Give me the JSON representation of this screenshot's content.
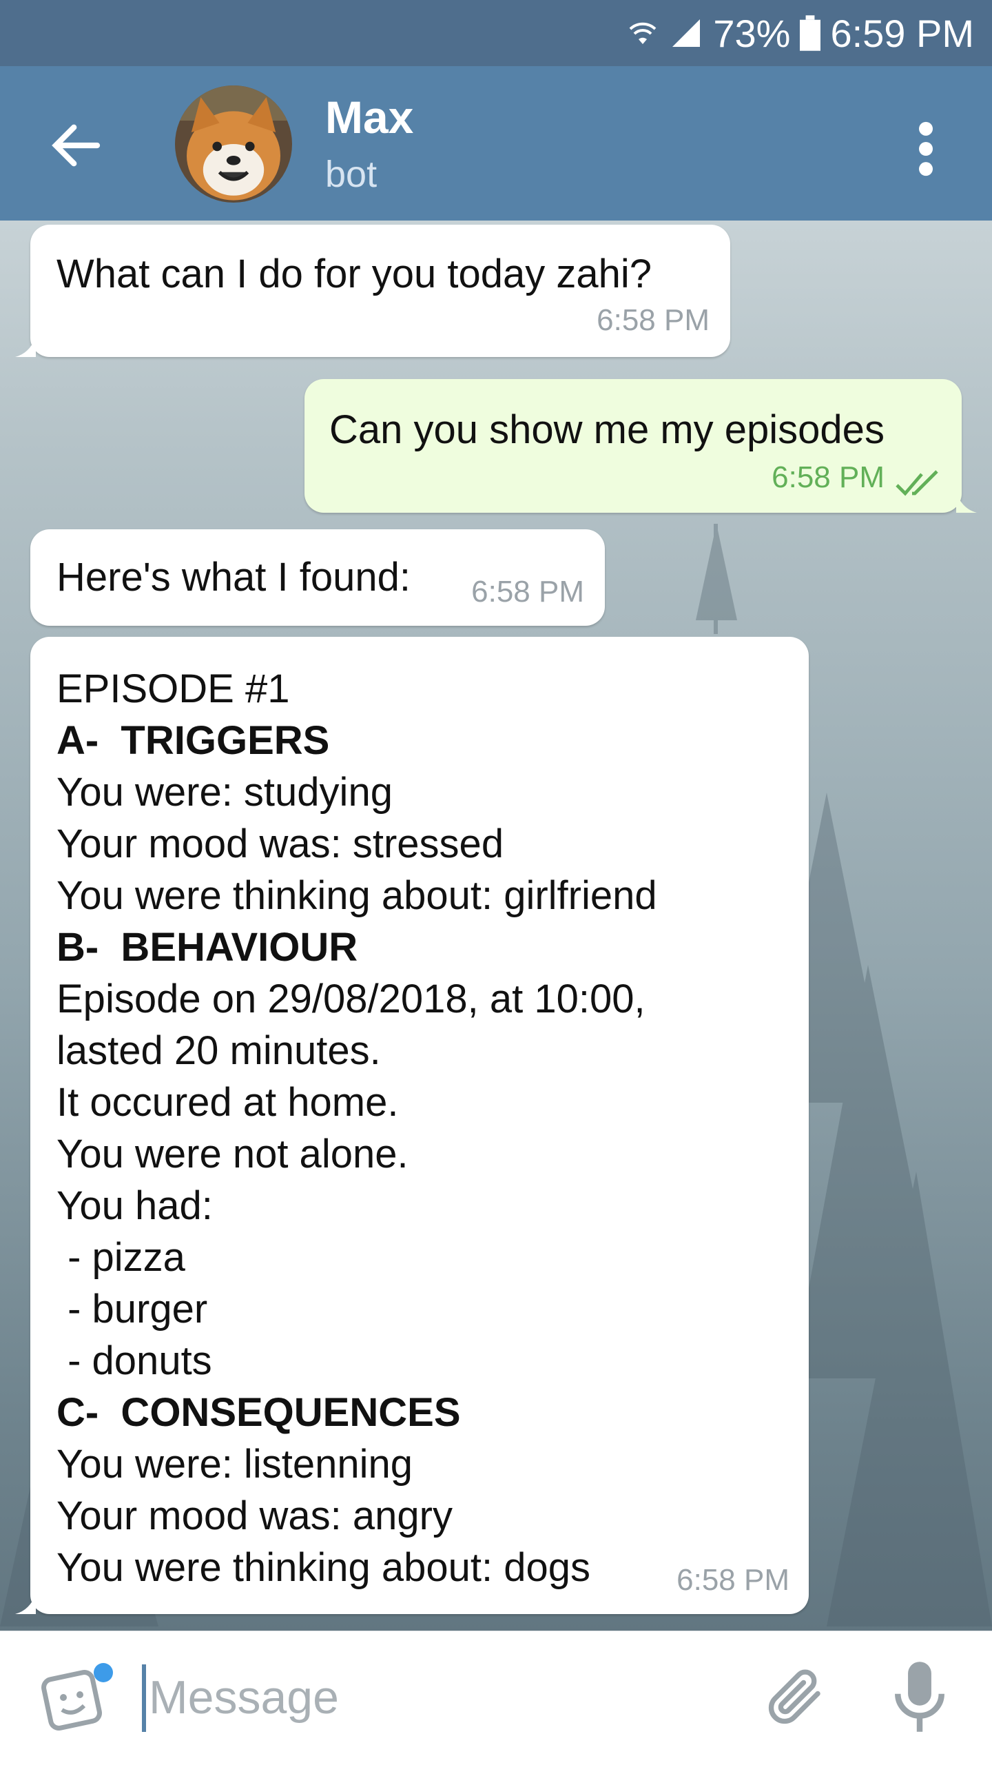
{
  "status_bar": {
    "battery": "73%",
    "time": "6:59 PM"
  },
  "header": {
    "title": "Max",
    "subtitle": "bot"
  },
  "messages": [
    {
      "direction": "incoming",
      "text": "What can I do for you today zahi?",
      "time": "6:58 PM"
    },
    {
      "direction": "outgoing",
      "text": "Can you show me my episodes",
      "time": "6:58 PM",
      "status": "read"
    },
    {
      "direction": "incoming",
      "text": "Here's what I found:",
      "time": "6:58 PM"
    },
    {
      "direction": "incoming",
      "time": "6:58 PM",
      "lines": [
        {
          "text": "EPISODE #1",
          "bold": false
        },
        {
          "text": "A-  TRIGGERS",
          "bold": true
        },
        {
          "text": "You were: studying",
          "bold": false
        },
        {
          "text": "Your mood was: stressed",
          "bold": false
        },
        {
          "text": "You were thinking about: girlfriend",
          "bold": false
        },
        {
          "text": "B-  BEHAVIOUR",
          "bold": true
        },
        {
          "text": "Episode on 29/08/2018, at 10:00,",
          "bold": false
        },
        {
          "text": "lasted 20 minutes.",
          "bold": false
        },
        {
          "text": "It occured at home.",
          "bold": false
        },
        {
          "text": "You were not alone.",
          "bold": false
        },
        {
          "text": "You had:",
          "bold": false
        },
        {
          "text": " - pizza",
          "bold": false
        },
        {
          "text": " - burger",
          "bold": false
        },
        {
          "text": " - donuts",
          "bold": false
        },
        {
          "text": "C-  CONSEQUENCES",
          "bold": true
        },
        {
          "text": "You were: listenning",
          "bold": false
        },
        {
          "text": "Your mood was: angry",
          "bold": false
        },
        {
          "text": "You were thinking about: dogs",
          "bold": false
        }
      ]
    }
  ],
  "input": {
    "placeholder": "Message"
  },
  "colors": {
    "header": "#5682a8",
    "status_bar": "#4f6e8d",
    "outgoing_bubble": "#effdde",
    "incoming_bubble": "#ffffff",
    "read_ticks": "#62b058"
  },
  "icons": [
    "wifi-icon",
    "signal-icon",
    "battery-icon",
    "back-arrow-icon",
    "more-vertical-icon",
    "sticker-icon",
    "attach-icon",
    "microphone-icon",
    "double-check-icon"
  ]
}
